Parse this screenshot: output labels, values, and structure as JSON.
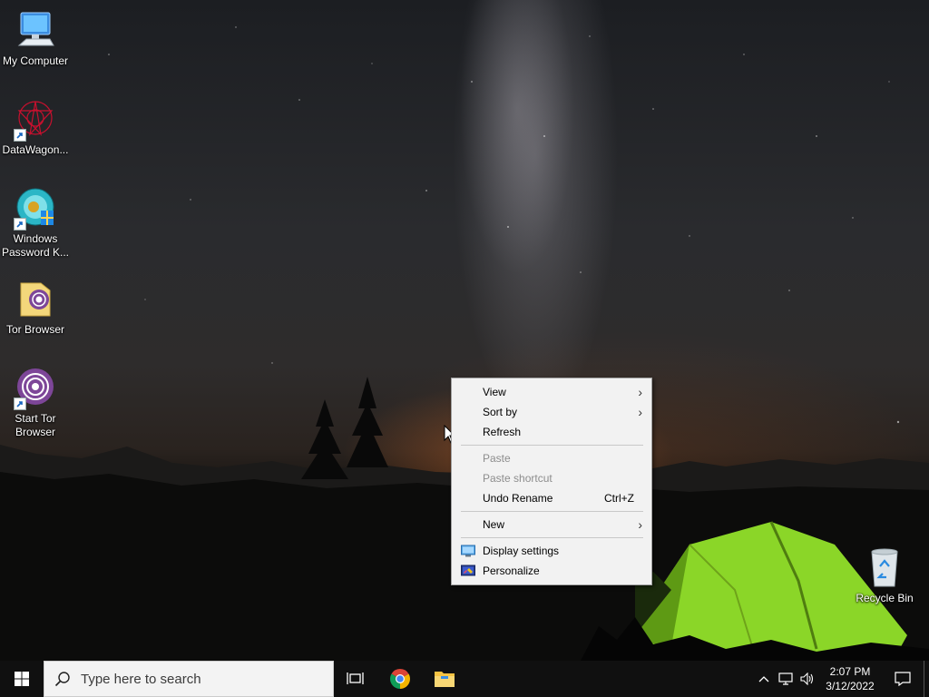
{
  "desktop": {
    "icons": [
      {
        "label": "My Computer",
        "icon": "computer-icon"
      },
      {
        "label": "DataWagon...",
        "icon": "datawagon-icon"
      },
      {
        "label": "Windows Password K...",
        "icon": "password-key-icon"
      },
      {
        "label": "Tor Browser",
        "icon": "folder-tor-icon"
      },
      {
        "label": "Start Tor Browser",
        "icon": "tor-browser-icon"
      },
      {
        "label": "Recycle Bin",
        "icon": "recycle-bin-icon"
      }
    ]
  },
  "context_menu": {
    "items": {
      "view": {
        "label": "View",
        "submenu": true
      },
      "sort_by": {
        "label": "Sort by",
        "submenu": true
      },
      "refresh": {
        "label": "Refresh"
      },
      "paste": {
        "label": "Paste",
        "disabled": true
      },
      "paste_shortcut": {
        "label": "Paste shortcut",
        "disabled": true
      },
      "undo_rename": {
        "label": "Undo Rename",
        "shortcut": "Ctrl+Z"
      },
      "new": {
        "label": "New",
        "submenu": true
      },
      "display_settings": {
        "label": "Display settings",
        "icon": "display-settings-icon"
      },
      "personalize": {
        "label": "Personalize",
        "icon": "personalize-icon"
      }
    }
  },
  "taskbar": {
    "search_placeholder": "Type here to search",
    "pinned": [
      "task-view-icon",
      "chrome-icon",
      "file-explorer-icon"
    ],
    "clock": {
      "time": "2:07 PM",
      "date": "3/12/2022"
    }
  },
  "colors": {
    "taskbar_bg": "#101010",
    "menu_bg": "#f2f2f2",
    "windows_accent": "#ffffff"
  }
}
